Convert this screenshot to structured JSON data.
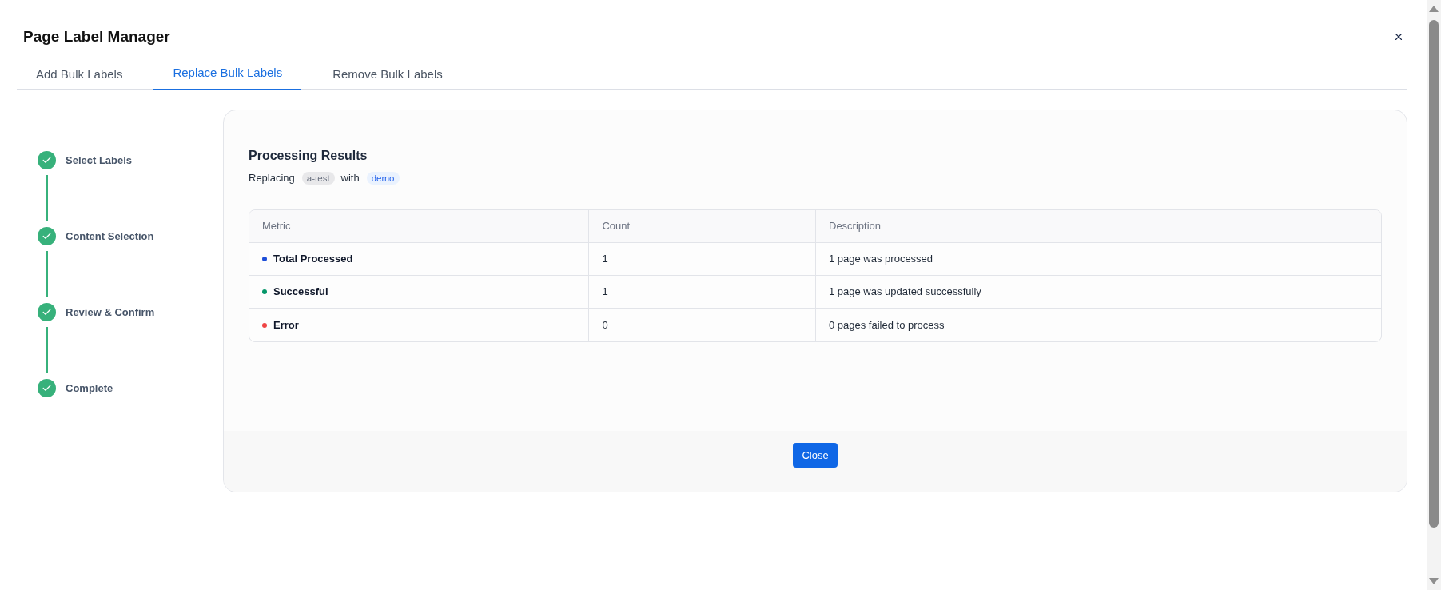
{
  "dialog": {
    "title": "Page Label Manager"
  },
  "tabs": [
    {
      "label": "Add Bulk Labels",
      "selected": false
    },
    {
      "label": "Replace Bulk Labels",
      "selected": true
    },
    {
      "label": "Remove Bulk Labels",
      "selected": false
    }
  ],
  "steps": [
    {
      "label": "Select Labels",
      "completed": true
    },
    {
      "label": "Content Selection",
      "completed": true
    },
    {
      "label": "Review & Confirm",
      "completed": true
    },
    {
      "label": "Complete",
      "completed": true
    }
  ],
  "results": {
    "title": "Processing Results",
    "summary": {
      "prefix": "Replacing",
      "old_label": "a-test",
      "joiner": "with",
      "new_label": "demo"
    },
    "table": {
      "columns": [
        "Metric",
        "Count",
        "Description"
      ],
      "rows": [
        {
          "metric": "Total Processed",
          "color": "#1d4ed8",
          "count": "1",
          "description": "1 page was processed"
        },
        {
          "metric": "Successful",
          "color": "#059669",
          "count": "1",
          "description": "1 page was updated successfully"
        },
        {
          "metric": "Error",
          "color": "#ef4444",
          "count": "0",
          "description": "0 pages failed to process"
        }
      ]
    },
    "button": "Close"
  }
}
